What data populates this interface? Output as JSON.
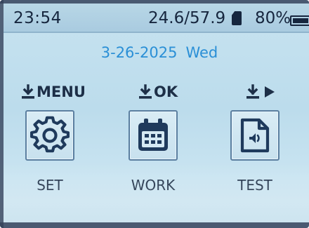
{
  "status_bar": {
    "time": "23:54",
    "temperature": "24.6/57.9",
    "storage_icon": "sd-card-icon",
    "battery_percent": "80%",
    "battery_icon": "battery-icon"
  },
  "date": {
    "date": "3-26-2025",
    "weekday": "Wed"
  },
  "key_hints": {
    "menu": {
      "icon": "download-icon",
      "label": "MENU"
    },
    "ok": {
      "icon": "download-icon",
      "label": "OK"
    },
    "play": {
      "icon": "download-icon",
      "symbol_icon": "play-icon"
    }
  },
  "tiles": [
    {
      "icon": "gear-icon",
      "label": "SET"
    },
    {
      "icon": "calendar-icon",
      "label": "WORK"
    },
    {
      "icon": "audio-file-icon",
      "label": "TEST"
    }
  ],
  "colors": {
    "background": "#c2dfed",
    "text": "#1d2f47",
    "date_accent": "#2a8fd6",
    "icon": "#1f3a5c"
  }
}
